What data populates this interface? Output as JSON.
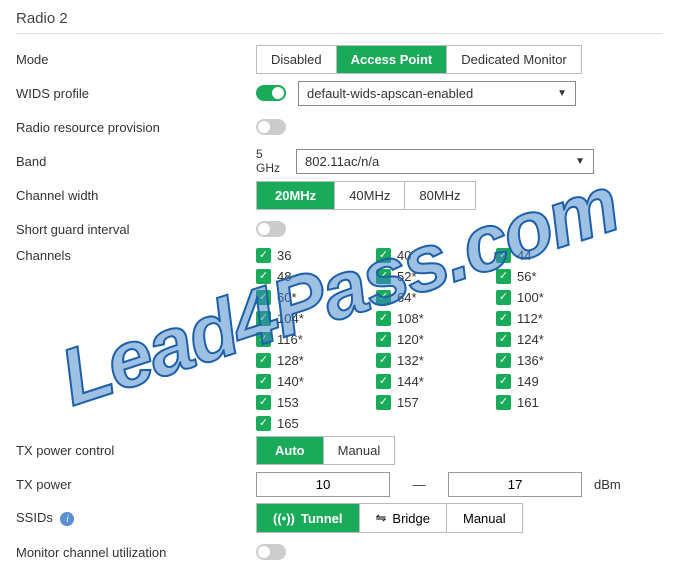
{
  "section_title": "Radio 2",
  "watermark": "Lead4Pass.com",
  "rows": {
    "mode": {
      "label": "Mode",
      "options": [
        "Disabled",
        "Access Point",
        "Dedicated Monitor"
      ],
      "active": 1
    },
    "wids": {
      "label": "WIDS profile",
      "toggle_on": true,
      "value": "default-wids-apscan-enabled"
    },
    "rrp": {
      "label": "Radio resource provision",
      "toggle_on": false
    },
    "band": {
      "label": "Band",
      "prefix": "5 GHz",
      "value": "802.11ac/n/a"
    },
    "chw": {
      "label": "Channel width",
      "options": [
        "20MHz",
        "40MHz",
        "80MHz"
      ],
      "active": 0
    },
    "sgi": {
      "label": "Short guard interval",
      "toggle_on": false
    },
    "channels_label": "Channels",
    "channels": [
      "36",
      "40",
      "44",
      "48",
      "52*",
      "56*",
      "60*",
      "64*",
      "100*",
      "104*",
      "108*",
      "112*",
      "116*",
      "120*",
      "124*",
      "128*",
      "132*",
      "136*",
      "140*",
      "144*",
      "149",
      "153",
      "157",
      "161",
      "165"
    ],
    "txpc": {
      "label": "TX power control",
      "options": [
        "Auto",
        "Manual"
      ],
      "active": 0
    },
    "txpw": {
      "label": "TX power",
      "low": "10",
      "high": "17",
      "unit": "dBm"
    },
    "ssid": {
      "label": "SSIDs",
      "options": [
        "Tunnel",
        "Bridge",
        "Manual"
      ],
      "active": 0,
      "tunnel_icon": "((•))",
      "bridge_icon": "⇋"
    },
    "mcu": {
      "label": "Monitor channel utilization",
      "toggle_on": false
    }
  }
}
